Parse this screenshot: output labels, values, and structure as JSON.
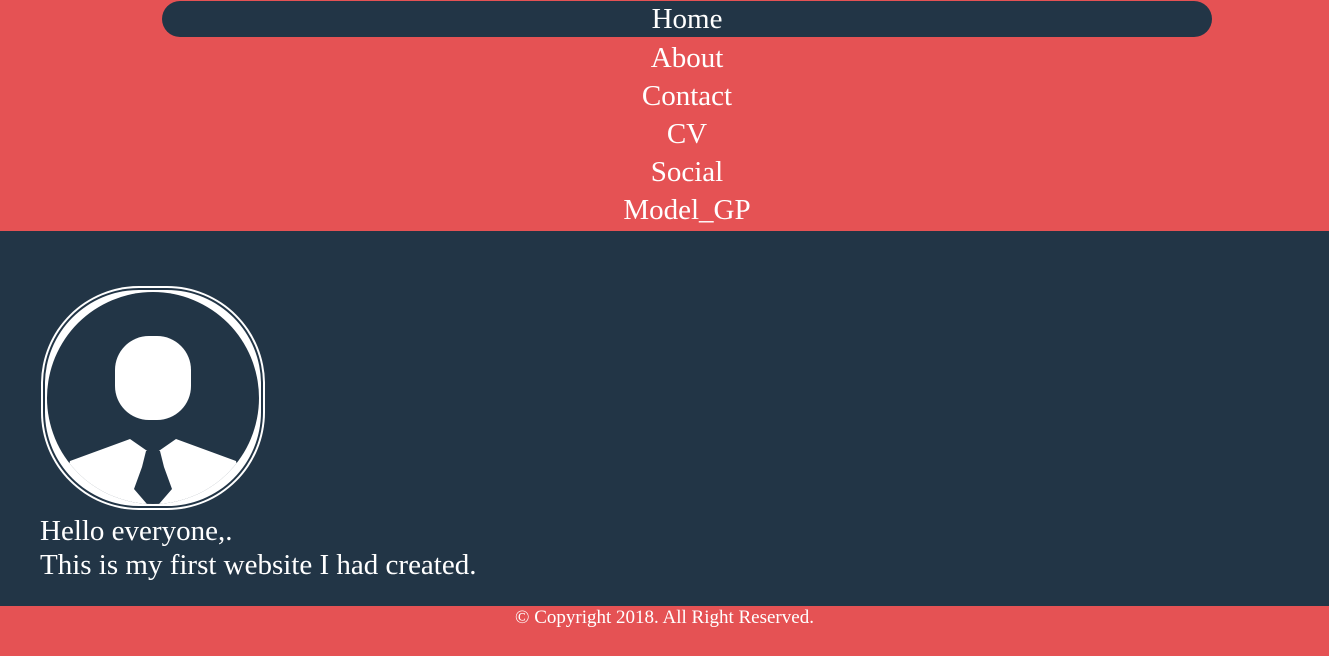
{
  "nav": {
    "items": [
      {
        "label": "Home",
        "active": true
      },
      {
        "label": "About",
        "active": false
      },
      {
        "label": "Contact",
        "active": false
      },
      {
        "label": "CV",
        "active": false
      },
      {
        "label": "Social",
        "active": false
      },
      {
        "label": "Model_GP",
        "active": false
      }
    ]
  },
  "profile": {
    "avatar_icon": "user-tie-icon",
    "line1": "Hello everyone,.",
    "line2": "This is my first website I had created."
  },
  "footer": {
    "copyright": "© Copyright 2018. All Right Reserved."
  },
  "colors": {
    "primary": "#e55254",
    "dark": "#223546",
    "text": "#ffffff"
  }
}
